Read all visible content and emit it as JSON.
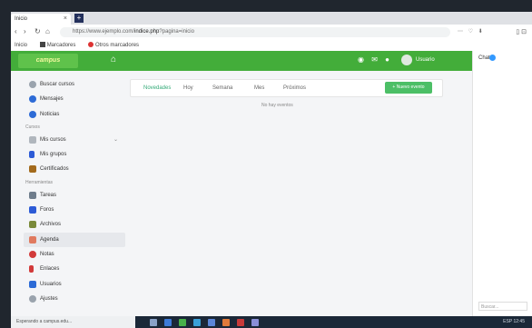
{
  "browser": {
    "tab_title": "Inicio",
    "tab_close": "×",
    "new_tab": "+",
    "nav_back": "‹",
    "nav_forward": "›",
    "url_prefix": "https://www.ejemplo.com/",
    "url_bold": "indice.php",
    "url_suffix": "?pagina=inicio",
    "sidebar_button": "▯ ⊡",
    "bookmarks": [
      "Inicio",
      "Marcadores",
      "Otros marcadores"
    ]
  },
  "app": {
    "logo_text": "campus",
    "home_icon": "home-icon",
    "user_name": "Usuario",
    "accent": "#43ad3a"
  },
  "sidebar": {
    "top_items": [
      {
        "label": "Buscar cursos",
        "icon": "search-icon",
        "color": "#9aa3ad"
      },
      {
        "label": "Mensajes",
        "icon": "chat-icon",
        "color": "#2d6bd6"
      },
      {
        "label": "Noticias",
        "icon": "globe-icon",
        "color": "#2d6bd6"
      }
    ],
    "section1_title": "Cursos",
    "section1_items": [
      {
        "label": "Mis cursos",
        "icon": "calendar-icon",
        "color": "#b0b6bd",
        "chevron": "⌄"
      },
      {
        "label": "Mis grupos",
        "icon": "phone-icon",
        "color": "#2d5bd6"
      },
      {
        "label": "Certificados",
        "icon": "certificate-icon",
        "color": "#a36a1c"
      }
    ],
    "section2_title": "Herramientas",
    "section2_items": [
      {
        "label": "Tareas",
        "icon": "chart-icon",
        "color": "#6f7d8c"
      },
      {
        "label": "Foros",
        "icon": "flag-icon",
        "color": "#2d5bd6"
      },
      {
        "label": "Archivos",
        "icon": "folder-icon",
        "color": "#7a8a3a"
      },
      {
        "label": "Agenda",
        "icon": "calendar-icon",
        "color": "#e07a5f",
        "selected": true
      },
      {
        "label": "Notas",
        "icon": "badge-icon",
        "color": "#d23a3a"
      },
      {
        "label": "Enlaces",
        "icon": "pin-icon",
        "color": "#d23a3a"
      },
      {
        "label": "Usuarios",
        "icon": "users-icon",
        "color": "#2d6bd6"
      },
      {
        "label": "Ajustes",
        "icon": "gear-icon",
        "color": "#9aa3ad"
      }
    ]
  },
  "main": {
    "tabs": [
      "Novedades",
      "Hoy",
      "Semana",
      "Mes",
      "Próximos"
    ],
    "new_button": "+ Nuevo evento",
    "empty_text": "No hay eventos"
  },
  "right_panel": {
    "title": "Chat",
    "input_placeholder": "Buscar..."
  },
  "status_text": "Esperando a campus.edu...",
  "taskbar": {
    "tray": "ESP 12:45"
  }
}
